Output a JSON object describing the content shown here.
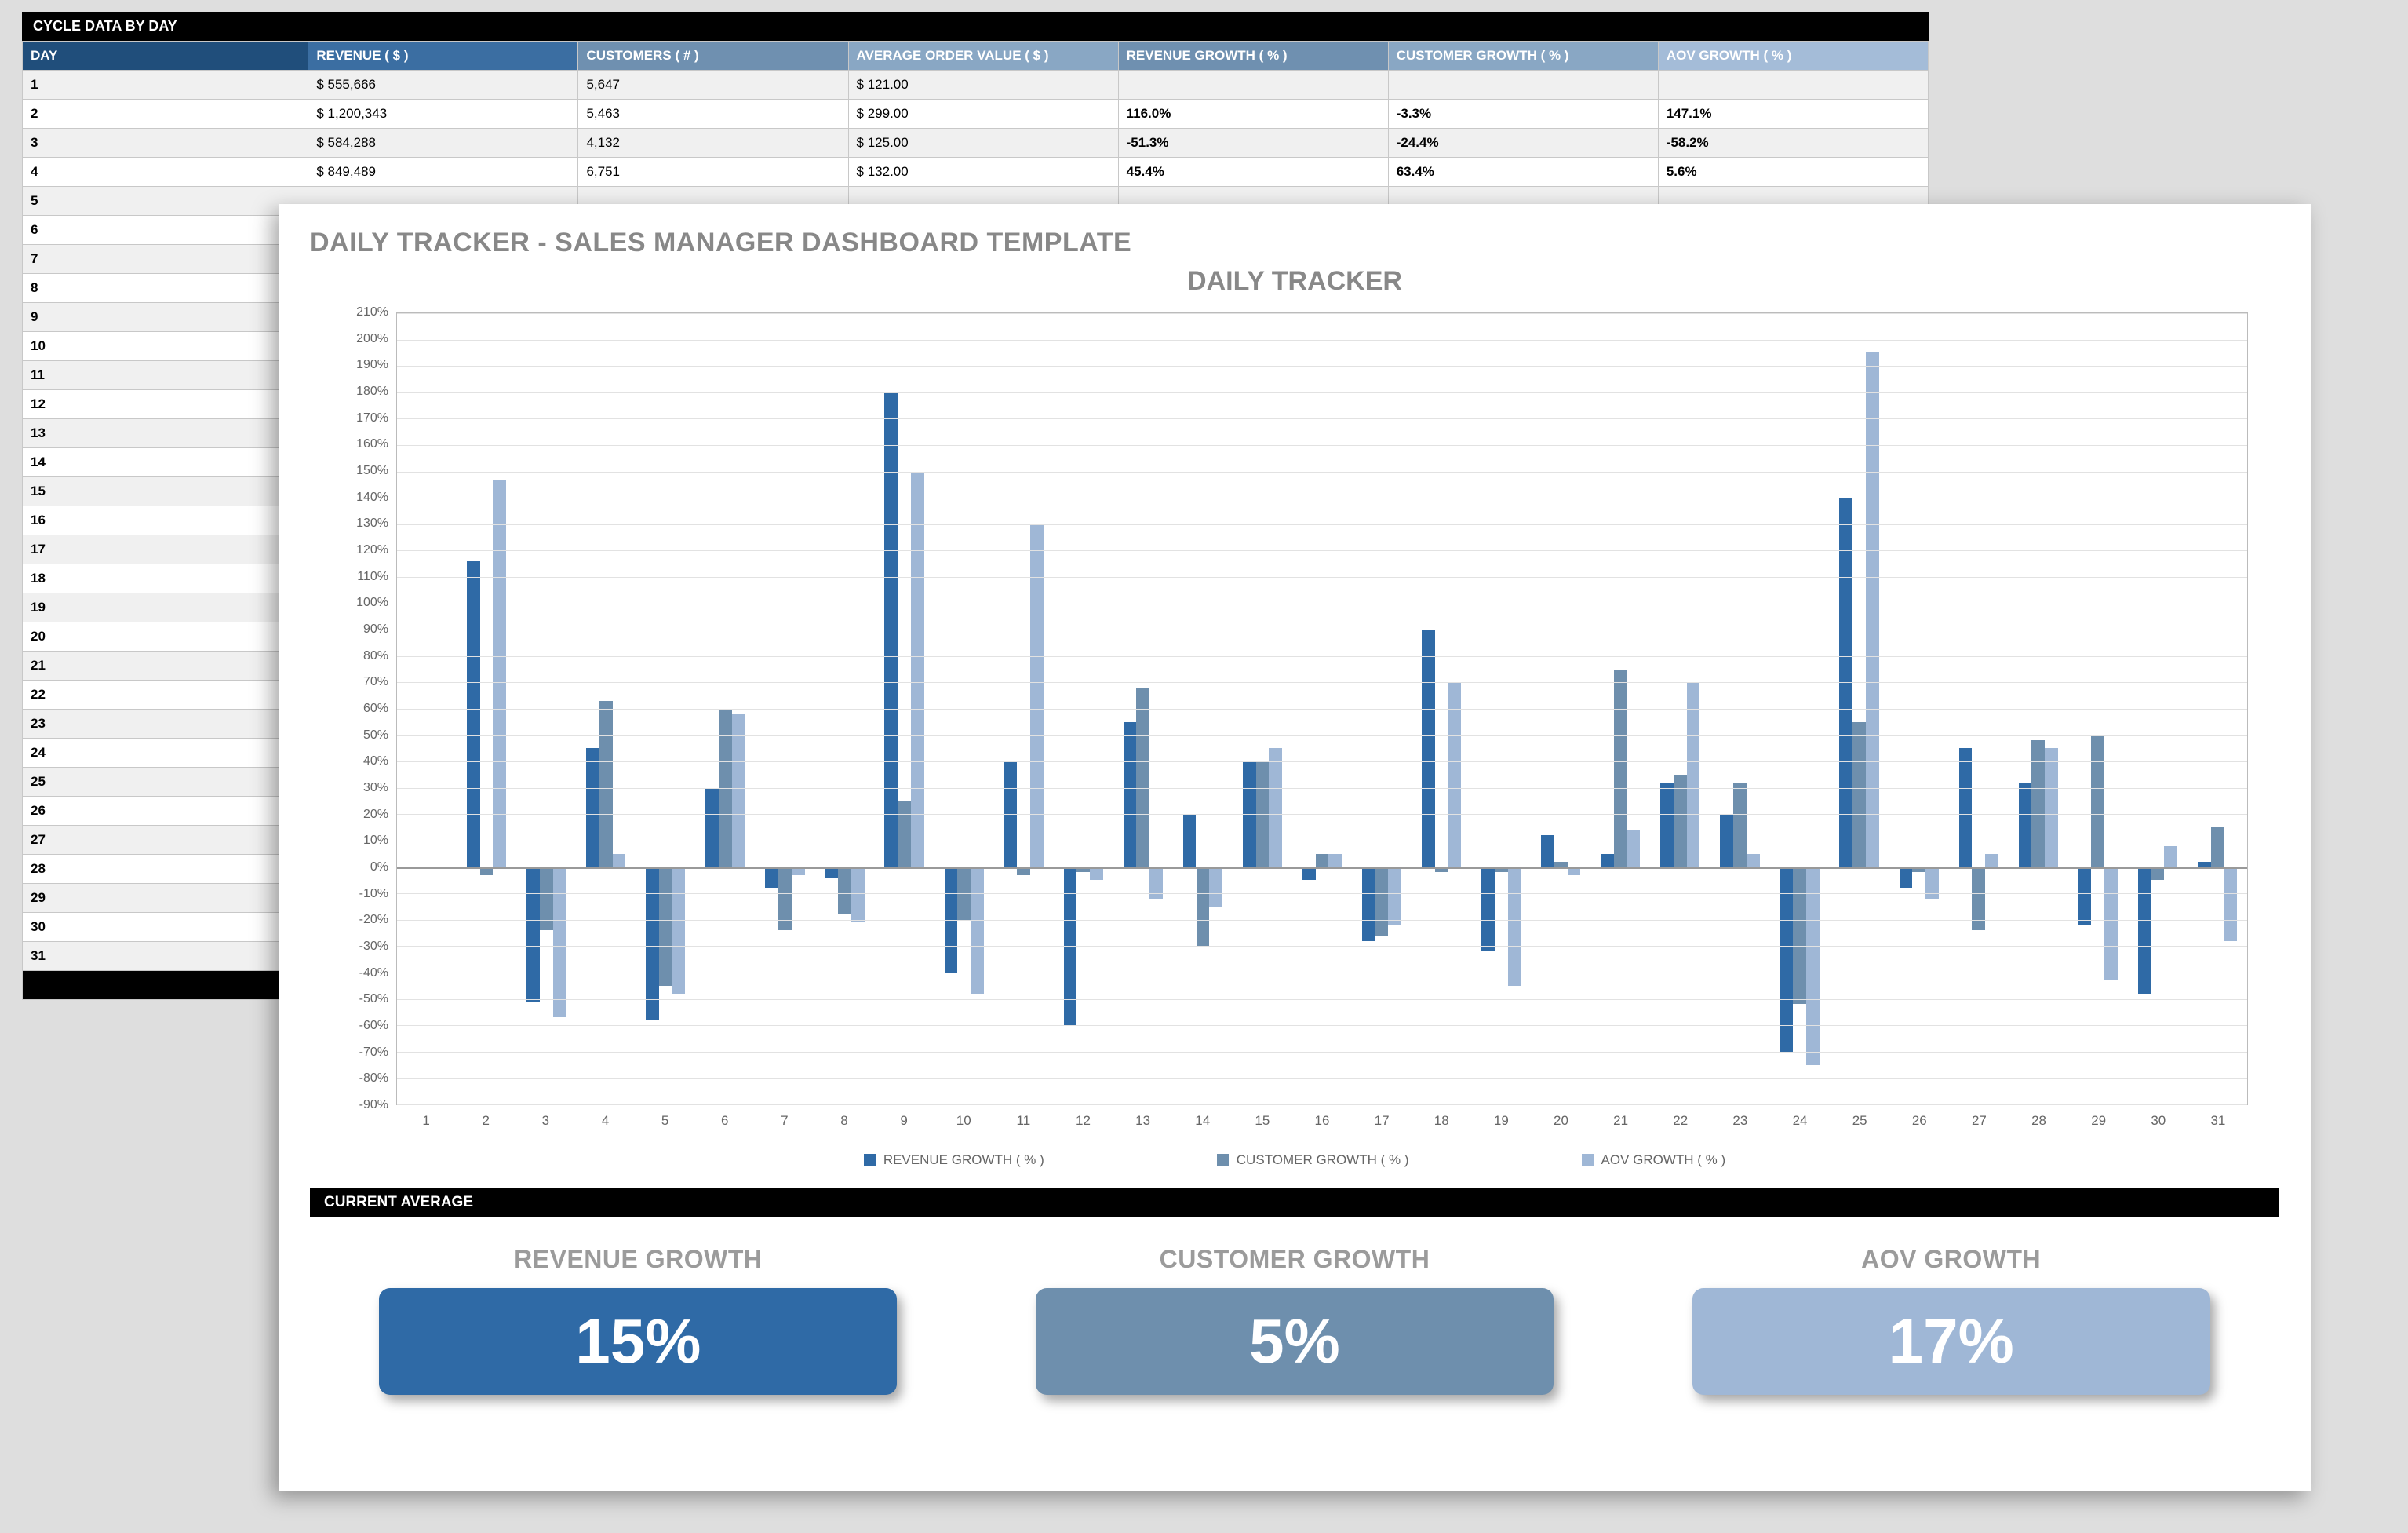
{
  "table": {
    "title": "CYCLE DATA BY DAY",
    "headers": {
      "day": "DAY",
      "revenue": "REVENUE  ( $ )",
      "customers": "CUSTOMERS  ( # )",
      "aov": "AVERAGE ORDER VALUE  ( $ )",
      "rg": "REVENUE GROWTH  ( % )",
      "cg": "CUSTOMER GROWTH  ( % )",
      "ag": "AOV GROWTH  ( % )"
    },
    "rows": [
      {
        "day": "1",
        "rev": "$                                  555,666",
        "cust": "5,647",
        "aov": "$                                       121.00",
        "rg": "",
        "cg": "",
        "ag": "",
        "grey": true
      },
      {
        "day": "2",
        "rev": "$                               1,200,343",
        "cust": "5,463",
        "aov": "$                                       299.00",
        "rg": "116.0%",
        "cg": "-3.3%",
        "ag": "147.1%"
      },
      {
        "day": "3",
        "rev": "$                                  584,288",
        "cust": "4,132",
        "aov": "$                                       125.00",
        "rg": "-51.3%",
        "cg": "-24.4%",
        "ag": "-58.2%",
        "grey": true
      },
      {
        "day": "4",
        "rev": "$                                  849,489",
        "cust": "6,751",
        "aov": "$                                       132.00",
        "rg": "45.4%",
        "cg": "63.4%",
        "ag": "5.6%"
      }
    ],
    "empty_days": [
      "5",
      "6",
      "7",
      "8",
      "9",
      "10",
      "11",
      "12",
      "13",
      "14",
      "15",
      "16",
      "17",
      "18",
      "19",
      "20",
      "21",
      "22",
      "23",
      "24",
      "25",
      "26",
      "27",
      "28",
      "29",
      "30",
      "31"
    ]
  },
  "dashboard": {
    "title": "DAILY TRACKER - SALES MANAGER DASHBOARD TEMPLATE",
    "chart_title": "DAILY TRACKER",
    "avg_title": "CURRENT AVERAGE",
    "stats": [
      {
        "label": "REVENUE GROWTH",
        "value": "15%"
      },
      {
        "label": "CUSTOMER GROWTH",
        "value": "5%"
      },
      {
        "label": "AOV GROWTH",
        "value": "17%"
      }
    ],
    "legend": [
      "REVENUE GROWTH  ( % )",
      "CUSTOMER GROWTH  ( % )",
      "AOV GROWTH  ( % )"
    ]
  },
  "chart_data": {
    "type": "bar",
    "title": "DAILY TRACKER",
    "xlabel": "",
    "ylabel": "",
    "ylim": [
      -90,
      210
    ],
    "yticks": [
      -90,
      -80,
      -70,
      -60,
      -50,
      -40,
      -30,
      -20,
      -10,
      0,
      10,
      20,
      30,
      40,
      50,
      60,
      70,
      80,
      90,
      100,
      110,
      120,
      130,
      140,
      150,
      160,
      170,
      180,
      190,
      200,
      210
    ],
    "categories": [
      "1",
      "2",
      "3",
      "4",
      "5",
      "6",
      "7",
      "8",
      "9",
      "10",
      "11",
      "12",
      "13",
      "14",
      "15",
      "16",
      "17",
      "18",
      "19",
      "20",
      "21",
      "22",
      "23",
      "24",
      "25",
      "26",
      "27",
      "28",
      "29",
      "30",
      "31"
    ],
    "series": [
      {
        "name": "REVENUE GROWTH  ( % )",
        "color": "#2f6aa6",
        "values": [
          0,
          116,
          -51,
          45,
          -58,
          30,
          -8,
          -4,
          180,
          -40,
          40,
          -60,
          55,
          20,
          40,
          -5,
          -28,
          90,
          -32,
          12,
          5,
          32,
          20,
          -70,
          140,
          -8,
          45,
          32,
          -22,
          -48,
          2
        ]
      },
      {
        "name": "CUSTOMER GROWTH  ( % )",
        "color": "#6e8fad",
        "values": [
          0,
          -3,
          -24,
          63,
          -45,
          60,
          -24,
          -18,
          25,
          -20,
          -3,
          -2,
          68,
          -30,
          40,
          5,
          -26,
          -2,
          -2,
          2,
          75,
          35,
          32,
          -52,
          55,
          -2,
          -24,
          48,
          50,
          -5,
          15
        ]
      },
      {
        "name": "AOV GROWTH  ( % )",
        "color": "#9fb7d6",
        "values": [
          0,
          147,
          -57,
          5,
          -48,
          58,
          -3,
          -21,
          150,
          -48,
          130,
          -5,
          -12,
          -15,
          45,
          5,
          -22,
          70,
          -45,
          -3,
          14,
          70,
          5,
          -75,
          195,
          -12,
          5,
          45,
          -43,
          8,
          -28
        ]
      }
    ]
  }
}
